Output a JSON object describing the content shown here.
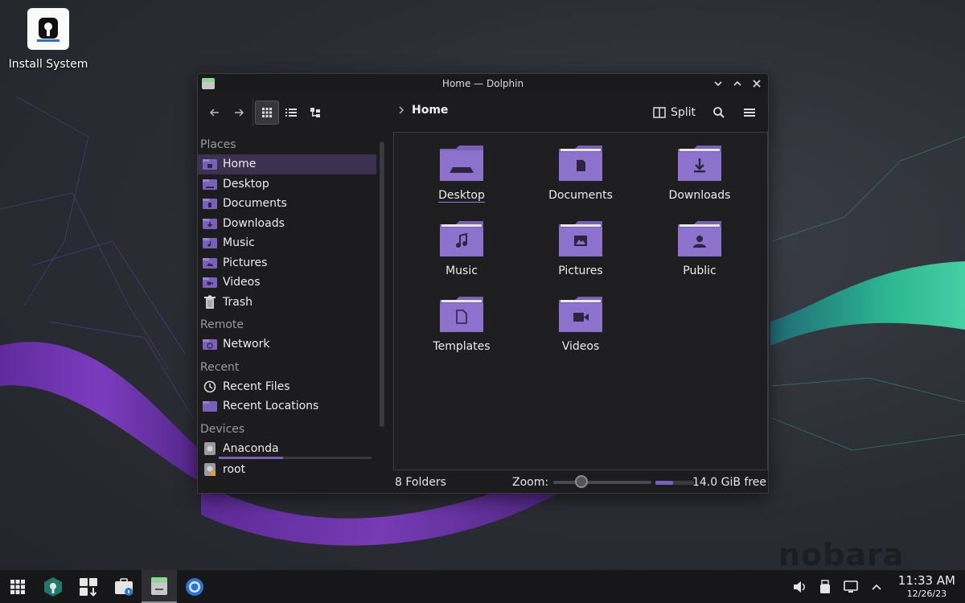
{
  "desktop": {
    "icons": [
      {
        "label": "Install System",
        "icon": "installer-icon"
      }
    ],
    "watermark": "nobara"
  },
  "window": {
    "title": "Home — Dolphin",
    "controls": [
      "minimize-icon",
      "maximize-icon",
      "close-icon"
    ]
  },
  "toolbar": {
    "back": "back-arrow-icon",
    "forward": "forward-arrow-icon",
    "views": [
      "icons-view",
      "details-view",
      "compact-view"
    ],
    "active_view": "icons-view",
    "breadcrumb": "Home",
    "split_label": "Split",
    "search": "search-icon",
    "menu": "hamburger-menu-icon"
  },
  "sidebar": {
    "sections": [
      {
        "title": "Places",
        "items": [
          {
            "label": "Home",
            "icon": "home-folder-icon",
            "selected": true
          },
          {
            "label": "Desktop",
            "icon": "desktop-folder-icon"
          },
          {
            "label": "Documents",
            "icon": "documents-folder-icon"
          },
          {
            "label": "Downloads",
            "icon": "downloads-folder-icon"
          },
          {
            "label": "Music",
            "icon": "music-folder-icon"
          },
          {
            "label": "Pictures",
            "icon": "pictures-folder-icon"
          },
          {
            "label": "Videos",
            "icon": "videos-folder-icon"
          },
          {
            "label": "Trash",
            "icon": "trash-icon"
          }
        ]
      },
      {
        "title": "Remote",
        "items": [
          {
            "label": "Network",
            "icon": "network-folder-icon"
          }
        ]
      },
      {
        "title": "Recent",
        "items": [
          {
            "label": "Recent Files",
            "icon": "clock-icon"
          },
          {
            "label": "Recent Locations",
            "icon": "folder-icon"
          }
        ]
      },
      {
        "title": "Devices",
        "items": [
          {
            "label": "Anaconda",
            "icon": "drive-icon",
            "usage": 0.42
          },
          {
            "label": "root",
            "icon": "drive-locked-icon"
          }
        ]
      }
    ]
  },
  "main": {
    "folders": [
      {
        "label": "Desktop",
        "glyph": "desktop",
        "hovered": true
      },
      {
        "label": "Documents",
        "glyph": "document"
      },
      {
        "label": "Downloads",
        "glyph": "download"
      },
      {
        "label": "Music",
        "glyph": "music"
      },
      {
        "label": "Pictures",
        "glyph": "picture"
      },
      {
        "label": "Public",
        "glyph": "user"
      },
      {
        "label": "Templates",
        "glyph": "template"
      },
      {
        "label": "Videos",
        "glyph": "video"
      }
    ]
  },
  "status": {
    "count": "8 Folders",
    "zoom_label": "Zoom:",
    "zoom_level": 0.25,
    "free_space": "14.0 GiB free",
    "used_fraction": 0.45
  },
  "taskbar": {
    "apps": [
      "app-launcher-icon",
      "discover-store-icon",
      "overview-icon",
      "welcome-icon",
      "dolphin-icon",
      "chromium-icon"
    ],
    "active_app": "dolphin-icon",
    "tray": [
      "volume-icon",
      "usb-device-icon",
      "display-icon",
      "tray-expand-icon"
    ],
    "time": "11:33 AM",
    "date": "12/26/23"
  }
}
